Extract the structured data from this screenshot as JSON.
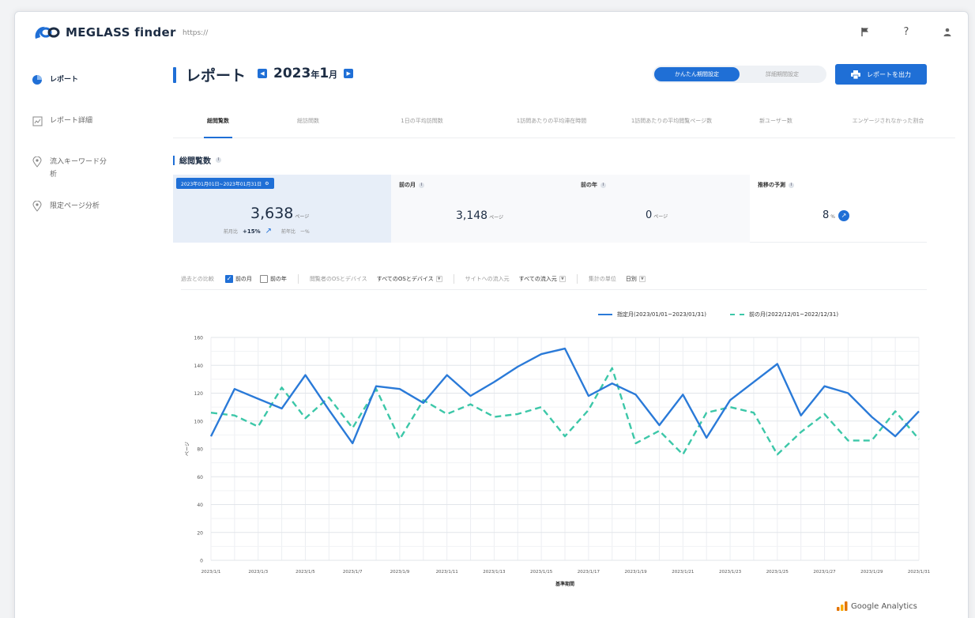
{
  "app": {
    "name": "MEGLASS finder",
    "url": "https://"
  },
  "colors": {
    "accent": "#1f6fd6",
    "series_current": "#2a7ad8",
    "series_prev": "#3cc7a8"
  },
  "top_icons": [
    "flag-icon",
    "help-icon",
    "user-icon"
  ],
  "sidebar": {
    "items": [
      {
        "label": "レポート",
        "icon": "report-icon"
      },
      {
        "label": "レポート詳細",
        "icon": "report-detail-icon"
      },
      {
        "label": "流入キーワード分析",
        "icon": "location-pin-icon"
      },
      {
        "label": "限定ページ分析",
        "icon": "location-pin-icon"
      }
    ]
  },
  "header": {
    "title": "レポート",
    "month_year": "2023",
    "month_year_unit": "年",
    "month": "1",
    "month_unit": "月",
    "toggle": {
      "simple": "かんたん期間設定",
      "detail": "詳細期間設定"
    },
    "export_label": "レポートを出力"
  },
  "tabs": [
    {
      "label": "総閲覧数"
    },
    {
      "label": "総訪問数"
    },
    {
      "label": "1日の平均訪問数"
    },
    {
      "label": "1訪問あたりの平均滞在時間"
    },
    {
      "label": "1訪問あたりの平均閲覧ページ数"
    },
    {
      "label": "新ユーザー数"
    },
    {
      "label": "エンゲージされなかった割合"
    }
  ],
  "section": {
    "title": "総閲覧数"
  },
  "kpis": {
    "range_badge": "2023年01月01日~2023年01月31日",
    "current_value": "3,638",
    "unit": "ページ",
    "sub_label_1": "前月比",
    "sub_value_1": "+15%",
    "sub_label_2": "前年比",
    "sub_value_2": "ー%",
    "prev_month_label": "前の月",
    "prev_month_value": "3,148",
    "prev_year_label": "前の年",
    "prev_year_value": "0",
    "forecast_label": "推移の予測",
    "forecast_value": "8",
    "forecast_unit": "%"
  },
  "filters": {
    "compare_label": "過去との比較",
    "cb_prev_month": "前の月",
    "cb_prev_year": "前の年",
    "os_label": "閲覧者のOSとデバイス",
    "os_value": "すべてのOSとデバイス",
    "source_label": "サイトへの流入元",
    "source_value": "すべての流入元",
    "unit_label": "集計の単位",
    "unit_value": "日別"
  },
  "chart_data": {
    "type": "line",
    "ylabel": "ページ",
    "xlabel": "基準期間",
    "ylim": [
      0,
      160
    ],
    "yticks": [
      0,
      20,
      40,
      60,
      80,
      100,
      120,
      140,
      160
    ],
    "x": [
      "2023/1/1",
      "2023/1/2",
      "2023/1/3",
      "2023/1/4",
      "2023/1/5",
      "2023/1/6",
      "2023/1/7",
      "2023/1/8",
      "2023/1/9",
      "2023/1/10",
      "2023/1/11",
      "2023/1/12",
      "2023/1/13",
      "2023/1/14",
      "2023/1/15",
      "2023/1/16",
      "2023/1/17",
      "2023/1/18",
      "2023/1/19",
      "2023/1/20",
      "2023/1/21",
      "2023/1/22",
      "2023/1/23",
      "2023/1/24",
      "2023/1/25",
      "2023/1/26",
      "2023/1/27",
      "2023/1/28",
      "2023/1/29",
      "2023/1/30",
      "2023/1/31"
    ],
    "xtick_labels": [
      "2023/1/1",
      "2023/1/3",
      "2023/1/5",
      "2023/1/7",
      "2023/1/9",
      "2023/1/11",
      "2023/1/13",
      "2023/1/15",
      "2023/1/17",
      "2023/1/19",
      "2023/1/21",
      "2023/1/23",
      "2023/1/25",
      "2023/1/27",
      "2023/1/29",
      "2023/1/31"
    ],
    "grid": true,
    "legend_position": "top-right",
    "series": [
      {
        "name": "指定月(2023/01/01~2023/01/31)",
        "style": "solid",
        "values": [
          89,
          123,
          116,
          109,
          133,
          108,
          84,
          125,
          123,
          113,
          133,
          118,
          128,
          139,
          148,
          152,
          118,
          127,
          119,
          97,
          119,
          88,
          115,
          128,
          141,
          104,
          125,
          120,
          103,
          89,
          107
        ]
      },
      {
        "name": "前の月(2022/12/01~2022/12/31)",
        "style": "dashed",
        "values": [
          106,
          104,
          96,
          124,
          102,
          117,
          95,
          123,
          87,
          115,
          105,
          112,
          103,
          105,
          110,
          89,
          108,
          138,
          84,
          93,
          76,
          106,
          110,
          106,
          76,
          92,
          105,
          86,
          86,
          107,
          87
        ]
      }
    ]
  },
  "footer": {
    "ga_label": "Google Analytics"
  }
}
